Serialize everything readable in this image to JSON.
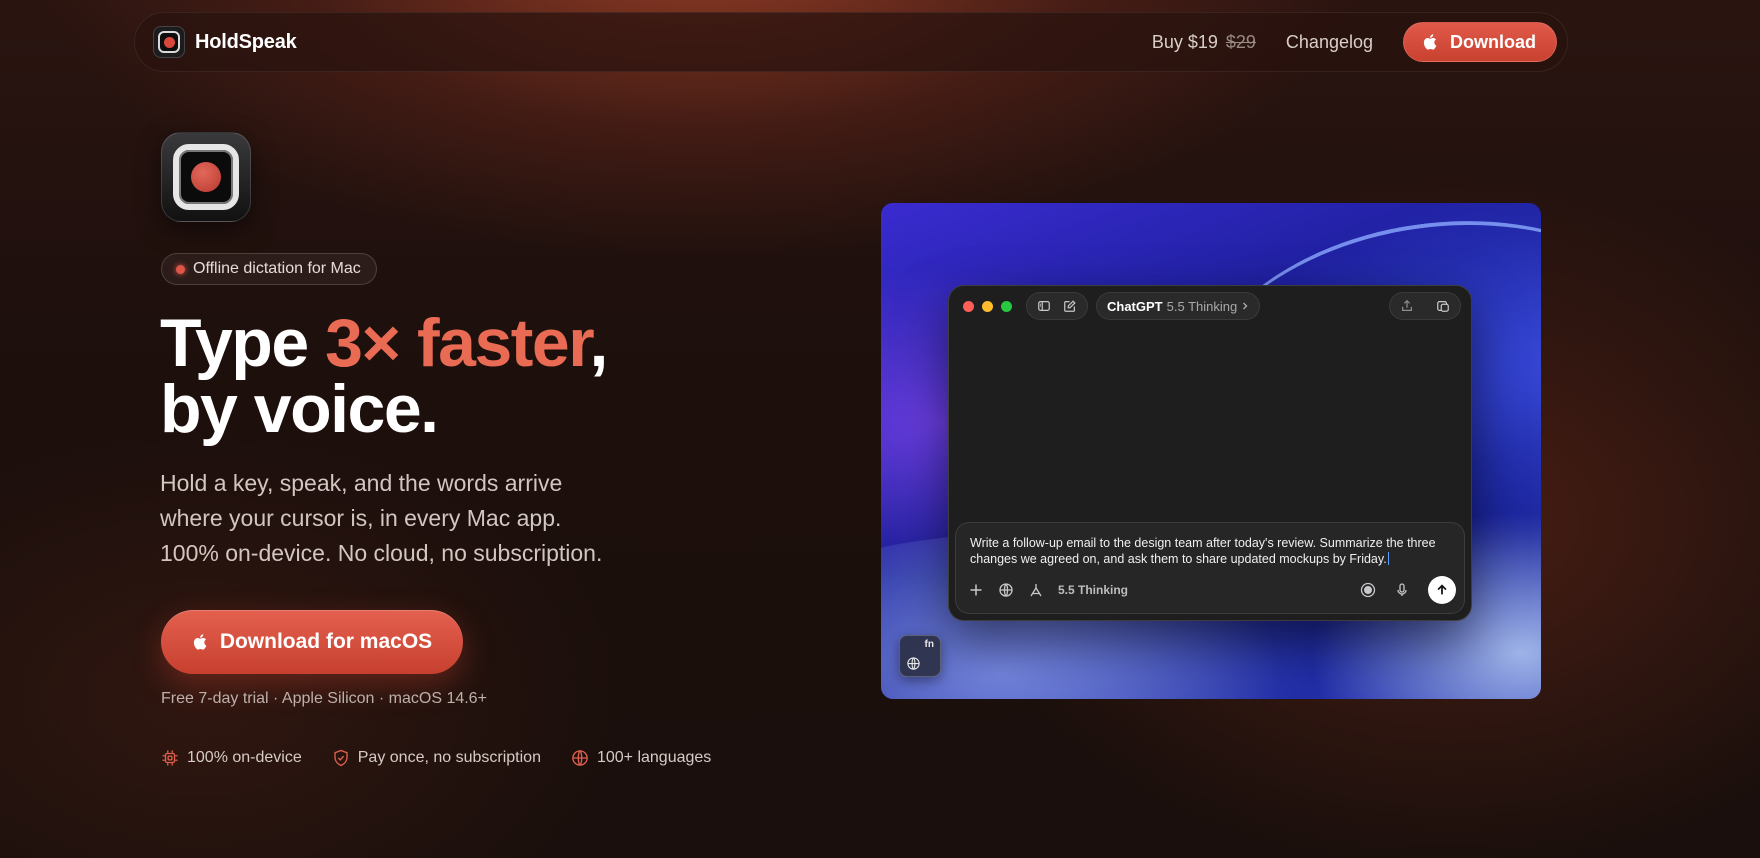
{
  "nav": {
    "brand": "HoldSpeak",
    "buy_label": "Buy $19",
    "buy_old_price": "$29",
    "changelog": "Changelog",
    "download": "Download"
  },
  "hero": {
    "badge": "Offline dictation for Mac",
    "headline_pre": "Type ",
    "headline_accent": "3× faster",
    "headline_comma": ",",
    "headline_line2": "by voice.",
    "subtext_line1": "Hold a key, speak, and the words arrive",
    "subtext_line2": "where your cursor is, in every Mac app.",
    "subtext_line3": "100% on-device. No cloud, no subscription.",
    "cta": "Download for macOS",
    "fineprint": "Free 7-day trial · Apple Silicon · macOS 14.6+",
    "features": [
      {
        "icon": "chip-icon",
        "label": "100% on-device"
      },
      {
        "icon": "shield-check-icon",
        "label": "Pay once, no subscription"
      },
      {
        "icon": "globe-icon",
        "label": "100+ languages"
      }
    ]
  },
  "mockup": {
    "model_name": "ChatGPT",
    "model_version": "5.5 Thinking",
    "composer_text": "Write a follow-up email to the design team after today's review. Summarize the three changes we agreed on, and ask them to share updated mockups by Friday.",
    "composer_mode": "5.5 Thinking",
    "fn_key": "fn"
  },
  "colors": {
    "accent": "#ea6b54",
    "button": "#d94d3c",
    "traffic_red": "#ff5f57",
    "traffic_yellow": "#febc2e",
    "traffic_green": "#28c840"
  }
}
